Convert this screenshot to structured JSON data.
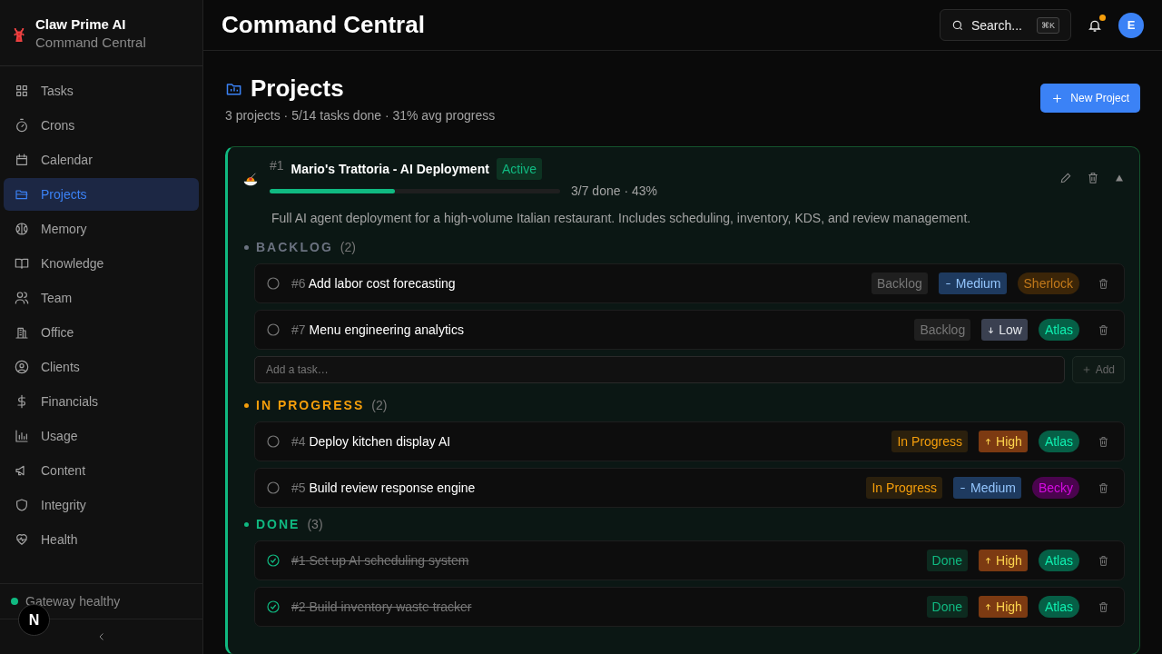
{
  "brand": {
    "name": "Claw Prime AI",
    "subtitle": "Command Central"
  },
  "nav": [
    {
      "label": "Tasks",
      "selected": false
    },
    {
      "label": "Crons",
      "selected": false
    },
    {
      "label": "Calendar",
      "selected": false
    },
    {
      "label": "Projects",
      "selected": true
    },
    {
      "label": "Memory",
      "selected": false
    },
    {
      "label": "Knowledge",
      "selected": false
    },
    {
      "label": "Team",
      "selected": false
    },
    {
      "label": "Office",
      "selected": false
    },
    {
      "label": "Clients",
      "selected": false
    },
    {
      "label": "Financials",
      "selected": false
    },
    {
      "label": "Usage",
      "selected": false
    },
    {
      "label": "Content",
      "selected": false
    },
    {
      "label": "Integrity",
      "selected": false
    },
    {
      "label": "Health",
      "selected": false
    }
  ],
  "gateway": {
    "label": "Gateway healthy",
    "color": "#10b981"
  },
  "dev_badge": "N",
  "header": {
    "title": "Command Central",
    "search": {
      "placeholder": "Search...",
      "shortcut": "⌘K"
    },
    "notifications_unread": true,
    "avatar": "E"
  },
  "page": {
    "title": "Projects",
    "summary": "3 projects · 5/14 tasks done · 31% avg progress",
    "new_button": "New Project"
  },
  "project": {
    "number": "#1",
    "name": "Mario's Trattoria - AI Deployment",
    "status": "Active",
    "level": 0.43,
    "progress_text": "3/7 done · 43%",
    "expanded": true,
    "description": "Full AI agent deployment for a high-volume Italian restaurant. Includes scheduling, inventory, KDS, and review management.",
    "groups": [
      {
        "kind": "backlog",
        "title": "BACKLOG",
        "count": "(2)",
        "tasks": [
          {
            "number": "#6",
            "title": "Add labor cost forecasting",
            "done": false,
            "status": {
              "kind": "backlog",
              "label": "Backlog"
            },
            "priority": {
              "kind": "medium",
              "label": "Medium"
            },
            "assignee": {
              "name": "Sherlock",
              "color": "#3b2508"
            }
          },
          {
            "number": "#7",
            "title": "Menu engineering analytics",
            "done": false,
            "status": {
              "kind": "backlog",
              "label": "Backlog"
            },
            "priority": {
              "kind": "low",
              "label": "Low"
            },
            "assignee": {
              "name": "Atlas",
              "color": "#065f46"
            }
          }
        ],
        "add_task": {
          "placeholder": "Add a task…",
          "button": "Add"
        }
      },
      {
        "kind": "in_progress",
        "title": "IN PROGRESS",
        "count": "(2)",
        "tasks": [
          {
            "number": "#4",
            "title": "Deploy kitchen display AI",
            "done": false,
            "status": {
              "kind": "in_progress",
              "label": "In Progress"
            },
            "priority": {
              "kind": "high",
              "label": "High"
            },
            "assignee": {
              "name": "Atlas",
              "color": "#065f46"
            }
          },
          {
            "number": "#5",
            "title": "Build review response engine",
            "done": false,
            "status": {
              "kind": "in_progress",
              "label": "In Progress"
            },
            "priority": {
              "kind": "medium",
              "label": "Medium"
            },
            "assignee": {
              "name": "Becky",
              "color": "#4a044e"
            }
          }
        ]
      },
      {
        "kind": "done",
        "title": "DONE",
        "count": "(3)",
        "tasks": [
          {
            "number": "#1",
            "title": "Set up AI scheduling system",
            "done": true,
            "status": {
              "kind": "done",
              "label": "Done"
            },
            "priority": {
              "kind": "high",
              "label": "High"
            },
            "assignee": {
              "name": "Atlas",
              "color": "#065f46"
            }
          },
          {
            "number": "#2",
            "title": "Build inventory waste tracker",
            "done": true,
            "status": {
              "kind": "done",
              "label": "Done"
            },
            "priority": {
              "kind": "high",
              "label": "High"
            },
            "assignee": {
              "name": "Atlas",
              "color": "#065f46"
            }
          }
        ]
      }
    ]
  }
}
